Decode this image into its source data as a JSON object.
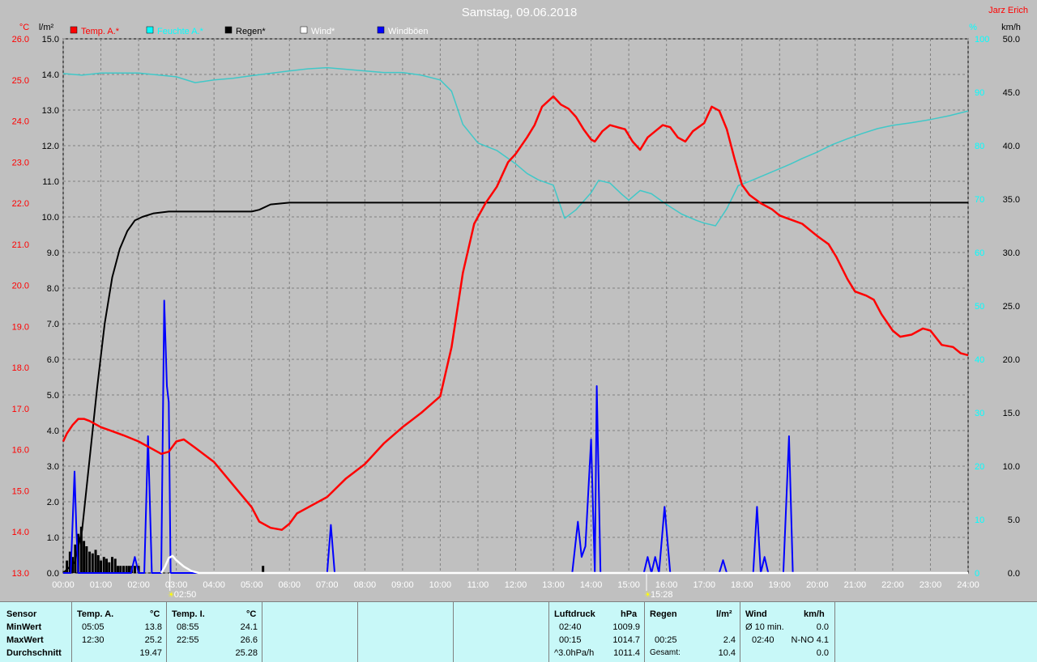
{
  "title": "Samstag, 09.06.2018",
  "author": "Jarz Erich",
  "axes": {
    "left_outer_unit": "°C",
    "left_inner_unit": "l/m²",
    "right_inner_unit": "%",
    "right_outer_unit": "km/h",
    "left_outer_ticks": [
      "26.0",
      "25.0",
      "24.0",
      "23.0",
      "22.0",
      "21.0",
      "20.0",
      "19.0",
      "18.0",
      "17.0",
      "16.0",
      "15.0",
      "14.0",
      "13.0"
    ],
    "left_inner_ticks": [
      "15.0",
      "14.0",
      "13.0",
      "12.0",
      "11.0",
      "10.0",
      "9.0",
      "8.0",
      "7.0",
      "6.0",
      "5.0",
      "4.0",
      "3.0",
      "2.0",
      "1.0",
      "0.0"
    ],
    "right_inner_ticks": [
      "100",
      "90",
      "80",
      "70",
      "60",
      "50",
      "40",
      "30",
      "20",
      "10",
      "0"
    ],
    "right_outer_ticks": [
      "50.0",
      "45.0",
      "40.0",
      "35.0",
      "30.0",
      "25.0",
      "20.0",
      "15.0",
      "10.0",
      "5.0",
      "0.0"
    ],
    "x_ticks": [
      "00:00",
      "01:00",
      "02:00",
      "03:00",
      "04:00",
      "05:00",
      "06:00",
      "07:00",
      "08:00",
      "09:00",
      "10:00",
      "11:00",
      "12:00",
      "13:00",
      "14:00",
      "15:00",
      "16:00",
      "17:00",
      "18:00",
      "19:00",
      "20:00",
      "21:00",
      "22:00",
      "23:00",
      "24:00"
    ]
  },
  "markers": [
    {
      "label": "02:50",
      "hour": 2.83
    },
    {
      "label": "15:28",
      "hour": 15.47
    }
  ],
  "colors": {
    "temp": "#ff0000",
    "humidity": "#00ffff",
    "humidity_line": "#40c8c8",
    "rain": "#000000",
    "wind": "#ffffff",
    "gust": "#0000ff",
    "grid": "#808080",
    "background": "#c0c0c0"
  },
  "chart_data": {
    "type": "line",
    "title": "Samstag, 09.06.2018",
    "x_range_hours": [
      0,
      24
    ],
    "series": [
      {
        "name": "Temp. A.*",
        "axis": "°C",
        "ylim": [
          13,
          26
        ],
        "points": [
          [
            0,
            16.2
          ],
          [
            0.1,
            16.4
          ],
          [
            0.25,
            16.6
          ],
          [
            0.4,
            16.75
          ],
          [
            0.55,
            16.75
          ],
          [
            0.7,
            16.7
          ],
          [
            1,
            16.55
          ],
          [
            1.3,
            16.45
          ],
          [
            1.6,
            16.35
          ],
          [
            2,
            16.2
          ],
          [
            2.2,
            16.1
          ],
          [
            2.4,
            16.0
          ],
          [
            2.6,
            15.9
          ],
          [
            2.8,
            15.95
          ],
          [
            3.0,
            16.2
          ],
          [
            3.2,
            16.25
          ],
          [
            3.5,
            16.05
          ],
          [
            4,
            15.7
          ],
          [
            4.5,
            15.15
          ],
          [
            5.0,
            14.6
          ],
          [
            5.2,
            14.25
          ],
          [
            5.5,
            14.1
          ],
          [
            5.8,
            14.05
          ],
          [
            6.0,
            14.2
          ],
          [
            6.2,
            14.45
          ],
          [
            6.5,
            14.6
          ],
          [
            7.0,
            14.85
          ],
          [
            7.5,
            15.3
          ],
          [
            8.0,
            15.65
          ],
          [
            8.5,
            16.15
          ],
          [
            9,
            16.55
          ],
          [
            9.5,
            16.9
          ],
          [
            10.0,
            17.3
          ],
          [
            10.3,
            18.5
          ],
          [
            10.6,
            20.3
          ],
          [
            10.9,
            21.5
          ],
          [
            11.2,
            22.0
          ],
          [
            11.5,
            22.4
          ],
          [
            11.8,
            23.0
          ],
          [
            12.0,
            23.2
          ],
          [
            12.3,
            23.6
          ],
          [
            12.5,
            23.9
          ],
          [
            12.7,
            24.35
          ],
          [
            13.0,
            24.6
          ],
          [
            13.2,
            24.4
          ],
          [
            13.4,
            24.3
          ],
          [
            13.6,
            24.1
          ],
          [
            13.8,
            23.8
          ],
          [
            14.0,
            23.55
          ],
          [
            14.1,
            23.5
          ],
          [
            14.3,
            23.75
          ],
          [
            14.5,
            23.9
          ],
          [
            14.7,
            23.85
          ],
          [
            14.9,
            23.8
          ],
          [
            15.1,
            23.5
          ],
          [
            15.3,
            23.3
          ],
          [
            15.5,
            23.6
          ],
          [
            15.7,
            23.75
          ],
          [
            15.9,
            23.9
          ],
          [
            16.1,
            23.85
          ],
          [
            16.3,
            23.6
          ],
          [
            16.5,
            23.5
          ],
          [
            16.7,
            23.75
          ],
          [
            17.0,
            23.95
          ],
          [
            17.2,
            24.35
          ],
          [
            17.4,
            24.25
          ],
          [
            17.6,
            23.8
          ],
          [
            17.8,
            23.1
          ],
          [
            18.0,
            22.45
          ],
          [
            18.2,
            22.2
          ],
          [
            18.5,
            22.0
          ],
          [
            18.8,
            21.85
          ],
          [
            19,
            21.7
          ],
          [
            19.3,
            21.6
          ],
          [
            19.6,
            21.5
          ],
          [
            20,
            21.2
          ],
          [
            20.3,
            21.0
          ],
          [
            20.5,
            20.7
          ],
          [
            20.8,
            20.15
          ],
          [
            21,
            19.85
          ],
          [
            21.3,
            19.75
          ],
          [
            21.5,
            19.65
          ],
          [
            21.7,
            19.3
          ],
          [
            22,
            18.9
          ],
          [
            22.2,
            18.75
          ],
          [
            22.5,
            18.8
          ],
          [
            22.8,
            18.95
          ],
          [
            23.0,
            18.9
          ],
          [
            23.3,
            18.55
          ],
          [
            23.6,
            18.5
          ],
          [
            23.8,
            18.35
          ],
          [
            24.0,
            18.3
          ]
        ]
      },
      {
        "name": "Feuchte A.*",
        "axis": "%",
        "ylim": [
          0,
          100
        ],
        "points": [
          [
            0,
            93.5
          ],
          [
            0.5,
            93.2
          ],
          [
            1,
            93.6
          ],
          [
            2,
            93.6
          ],
          [
            3,
            92.9
          ],
          [
            3.5,
            91.8
          ],
          [
            4,
            92.3
          ],
          [
            4.5,
            92.6
          ],
          [
            5,
            93.1
          ],
          [
            6,
            94.0
          ],
          [
            6.5,
            94.4
          ],
          [
            7,
            94.6
          ],
          [
            7.5,
            94.3
          ],
          [
            8,
            94.0
          ],
          [
            8.5,
            93.7
          ],
          [
            9,
            93.7
          ],
          [
            9.5,
            93.2
          ],
          [
            10,
            92.3
          ],
          [
            10.3,
            90.2
          ],
          [
            10.6,
            84.0
          ],
          [
            11.0,
            80.5
          ],
          [
            11.5,
            79.1
          ],
          [
            12,
            76.6
          ],
          [
            12.3,
            74.8
          ],
          [
            12.6,
            73.6
          ],
          [
            13.0,
            72.6
          ],
          [
            13.3,
            66.4
          ],
          [
            13.6,
            68.0
          ],
          [
            14.0,
            71.2
          ],
          [
            14.2,
            73.5
          ],
          [
            14.5,
            73.0
          ],
          [
            14.8,
            71.0
          ],
          [
            15.0,
            69.8
          ],
          [
            15.3,
            71.6
          ],
          [
            15.6,
            71.0
          ],
          [
            16.0,
            69.0
          ],
          [
            16.4,
            67.2
          ],
          [
            16.8,
            66.0
          ],
          [
            17.0,
            65.5
          ],
          [
            17.3,
            65.0
          ],
          [
            17.6,
            68.2
          ],
          [
            17.9,
            72.5
          ],
          [
            18.3,
            73.6
          ],
          [
            18.7,
            74.8
          ],
          [
            19,
            75.7
          ],
          [
            19.3,
            76.6
          ],
          [
            19.6,
            77.6
          ],
          [
            20,
            78.8
          ],
          [
            20.4,
            80.2
          ],
          [
            20.8,
            81.3
          ],
          [
            21.2,
            82.3
          ],
          [
            21.6,
            83.2
          ],
          [
            22,
            83.8
          ],
          [
            22.5,
            84.3
          ],
          [
            23,
            84.9
          ],
          [
            23.5,
            85.6
          ],
          [
            24,
            86.5
          ]
        ]
      },
      {
        "name": "Regen*",
        "axis": "l/m²",
        "ylim": [
          0,
          15
        ],
        "points": [
          [
            0,
            0
          ],
          [
            0.3,
            0.3
          ],
          [
            0.5,
            1.2
          ],
          [
            0.7,
            3.2
          ],
          [
            0.9,
            5.2
          ],
          [
            1.1,
            7.0
          ],
          [
            1.3,
            8.3
          ],
          [
            1.5,
            9.1
          ],
          [
            1.7,
            9.6
          ],
          [
            1.9,
            9.9
          ],
          [
            2.1,
            10.0
          ],
          [
            2.4,
            10.1
          ],
          [
            2.8,
            10.15
          ],
          [
            3.2,
            10.15
          ],
          [
            4,
            10.15
          ],
          [
            5.0,
            10.15
          ],
          [
            5.2,
            10.2
          ],
          [
            5.5,
            10.35
          ],
          [
            6,
            10.4
          ],
          [
            7,
            10.4
          ],
          [
            24,
            10.4
          ]
        ]
      },
      {
        "name": "Wind*",
        "axis": "km/h",
        "ylim": [
          0,
          50
        ],
        "points": [
          [
            2.6,
            0
          ],
          [
            2.7,
            0.6
          ],
          [
            2.8,
            1.4
          ],
          [
            2.9,
            1.6
          ],
          [
            3.0,
            1.2
          ],
          [
            3.2,
            0.6
          ],
          [
            3.4,
            0.2
          ],
          [
            3.6,
            0
          ],
          [
            24,
            0
          ]
        ]
      },
      {
        "name": "Windböen",
        "axis": "km/h",
        "ylim": [
          0,
          50
        ],
        "points": [
          [
            0,
            0
          ],
          [
            0.2,
            0
          ],
          [
            0.3,
            9.5
          ],
          [
            0.35,
            4
          ],
          [
            0.4,
            0
          ],
          [
            1.8,
            0
          ],
          [
            1.9,
            1.5
          ],
          [
            2.0,
            0
          ],
          [
            2.15,
            0
          ],
          [
            2.25,
            12.8
          ],
          [
            2.35,
            0
          ],
          [
            2.6,
            0
          ],
          [
            2.68,
            25.5
          ],
          [
            2.75,
            17.5
          ],
          [
            2.8,
            16.0
          ],
          [
            2.85,
            0
          ],
          [
            7.0,
            0
          ],
          [
            7.1,
            4.5
          ],
          [
            7.2,
            0
          ],
          [
            13.5,
            0
          ],
          [
            13.65,
            4.8
          ],
          [
            13.75,
            1.5
          ],
          [
            13.85,
            2.5
          ],
          [
            14.0,
            12.5
          ],
          [
            14.1,
            0
          ],
          [
            14.15,
            17.5
          ],
          [
            14.25,
            0
          ],
          [
            15.4,
            0
          ],
          [
            15.5,
            1.5
          ],
          [
            15.6,
            0
          ],
          [
            15.7,
            1.5
          ],
          [
            15.8,
            0
          ],
          [
            15.95,
            6.2
          ],
          [
            16.1,
            0
          ],
          [
            17.4,
            0
          ],
          [
            17.5,
            1.2
          ],
          [
            17.6,
            0
          ],
          [
            18.3,
            0
          ],
          [
            18.4,
            6.2
          ],
          [
            18.5,
            0
          ],
          [
            18.6,
            1.5
          ],
          [
            18.7,
            0
          ],
          [
            19.1,
            0
          ],
          [
            19.25,
            12.8
          ],
          [
            19.35,
            0
          ],
          [
            24,
            0
          ]
        ]
      }
    ],
    "rain_bars": {
      "name": "Regen (Intervall)",
      "axis": "l/m²",
      "bars": [
        [
          0.1,
          0.35
        ],
        [
          0.18,
          0.6
        ],
        [
          0.25,
          0.45
        ],
        [
          0.32,
          0.8
        ],
        [
          0.4,
          1.1
        ],
        [
          0.48,
          1.3
        ],
        [
          0.55,
          0.9
        ],
        [
          0.62,
          0.75
        ],
        [
          0.7,
          0.6
        ],
        [
          0.78,
          0.55
        ],
        [
          0.86,
          0.65
        ],
        [
          0.93,
          0.5
        ],
        [
          1.0,
          0.35
        ],
        [
          1.08,
          0.45
        ],
        [
          1.15,
          0.4
        ],
        [
          1.22,
          0.3
        ],
        [
          1.3,
          0.45
        ],
        [
          1.38,
          0.4
        ],
        [
          1.45,
          0.2
        ],
        [
          1.52,
          0.2
        ],
        [
          1.6,
          0.2
        ],
        [
          1.68,
          0.2
        ],
        [
          1.75,
          0.2
        ],
        [
          1.82,
          0.2
        ],
        [
          1.9,
          0.2
        ],
        [
          2.0,
          0.2
        ],
        [
          5.3,
          0.2
        ]
      ]
    }
  },
  "legend": [
    {
      "label": "Temp. A.*",
      "color": "#ff0000"
    },
    {
      "label": "Feuchte A.*",
      "color": "#00ffff"
    },
    {
      "label": "Regen*",
      "color": "#000000"
    },
    {
      "label": "Wind*",
      "color": "#ffffff"
    },
    {
      "label": "Windböen",
      "color": "#0000ff"
    }
  ],
  "stats": {
    "sensor_header": "Sensor",
    "row_labels": [
      "MinWert",
      "MaxWert",
      "Durchschnitt"
    ],
    "temp_a": {
      "header": "Temp. A.",
      "unit": "°C",
      "min_time": "05:05",
      "min": "13.8",
      "max_time": "12:30",
      "max": "25.2",
      "avg": "19.47"
    },
    "temp_i": {
      "header": "Temp. I.",
      "unit": "°C",
      "min_time": "08:55",
      "min": "24.1",
      "max_time": "22:55",
      "max": "26.6",
      "avg": "25.28"
    },
    "pressure": {
      "header": "Luftdruck",
      "unit": "hPa",
      "min_time": "02:40",
      "min": "1009.9",
      "max_time": "00:15",
      "max": "1014.7",
      "trend_label": "^3.0hPa/h",
      "trend": "1011.4"
    },
    "rain": {
      "header": "Regen",
      "unit": "l/m²",
      "max_time": "00:25",
      "max": "2.4",
      "total_label": "Gesamt:",
      "total": "10.4"
    },
    "wind": {
      "header": "Wind",
      "unit": "km/h",
      "avg_label": "Ø 10 min.",
      "avg": "0.0",
      "max_time": "02:40",
      "max": "N-NO 4.1",
      "third": "0.0"
    }
  }
}
